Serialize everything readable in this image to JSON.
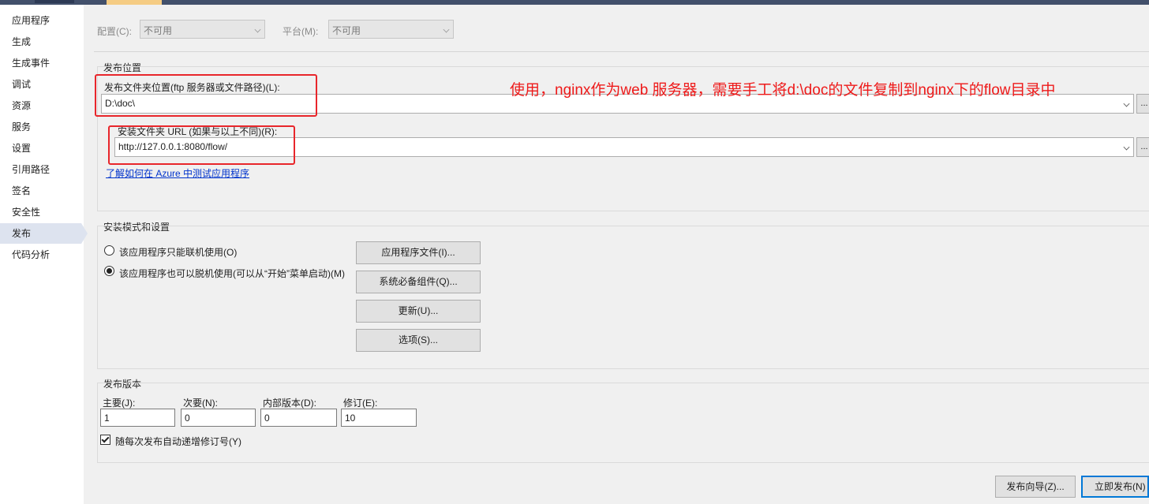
{
  "sidebar": {
    "items": [
      {
        "label": "应用程序",
        "active": false
      },
      {
        "label": "生成",
        "active": false
      },
      {
        "label": "生成事件",
        "active": false
      },
      {
        "label": "调试",
        "active": false
      },
      {
        "label": "资源",
        "active": false
      },
      {
        "label": "服务",
        "active": false
      },
      {
        "label": "设置",
        "active": false
      },
      {
        "label": "引用路径",
        "active": false
      },
      {
        "label": "签名",
        "active": false
      },
      {
        "label": "安全性",
        "active": false
      },
      {
        "label": "发布",
        "active": true
      },
      {
        "label": "代码分析",
        "active": false
      }
    ]
  },
  "config": {
    "config_label": "配置(C):",
    "config_value": "不可用",
    "platform_label": "平台(M):",
    "platform_value": "不可用"
  },
  "publish_location": {
    "group_title": "发布位置",
    "folder_label": "发布文件夹位置(ftp 服务器或文件路径)(L):",
    "folder_value": "D:\\doc\\",
    "browse_label": "...",
    "install_url_label": "安装文件夹 URL (如果与以上不同)(R):",
    "install_url_value": "http://127.0.0.1:8080/flow/",
    "install_browse_label": "...",
    "azure_link": "了解如何在 Azure 中测试应用程序"
  },
  "annotation": {
    "text": "使用，nginx作为web 服务器，需要手工将d:\\doc的文件复制到nginx下的flow目录中",
    "color": "#ee1a1a"
  },
  "install_mode": {
    "group_title": "安装模式和设置",
    "online_only_label": "该应用程序只能联机使用(O)",
    "offline_label": "该应用程序也可以脱机使用(可以从“开始”菜单启动)(M)",
    "selected": "offline",
    "buttons": {
      "app_files": "应用程序文件(I)...",
      "prerequisites": "系统必备组件(Q)...",
      "updates": "更新(U)...",
      "options": "选项(S)..."
    }
  },
  "publish_version": {
    "group_title": "发布版本",
    "major_label": "主要(J):",
    "major_value": "1",
    "minor_label": "次要(N):",
    "minor_value": "0",
    "build_label": "内部版本(D):",
    "build_value": "0",
    "revision_label": "修订(E):",
    "revision_value": "10",
    "auto_increment_label": "随每次发布自动递增修订号(Y)",
    "auto_increment_checked": true
  },
  "footer": {
    "wizard_button": "发布向导(Z)...",
    "publish_now_button": "立即发布(N)"
  },
  "colors": {
    "accent_blue": "#0078d7",
    "link_blue": "#0033cc",
    "sidebar_active": "#dde3ef",
    "title_bar": "#42506b"
  }
}
